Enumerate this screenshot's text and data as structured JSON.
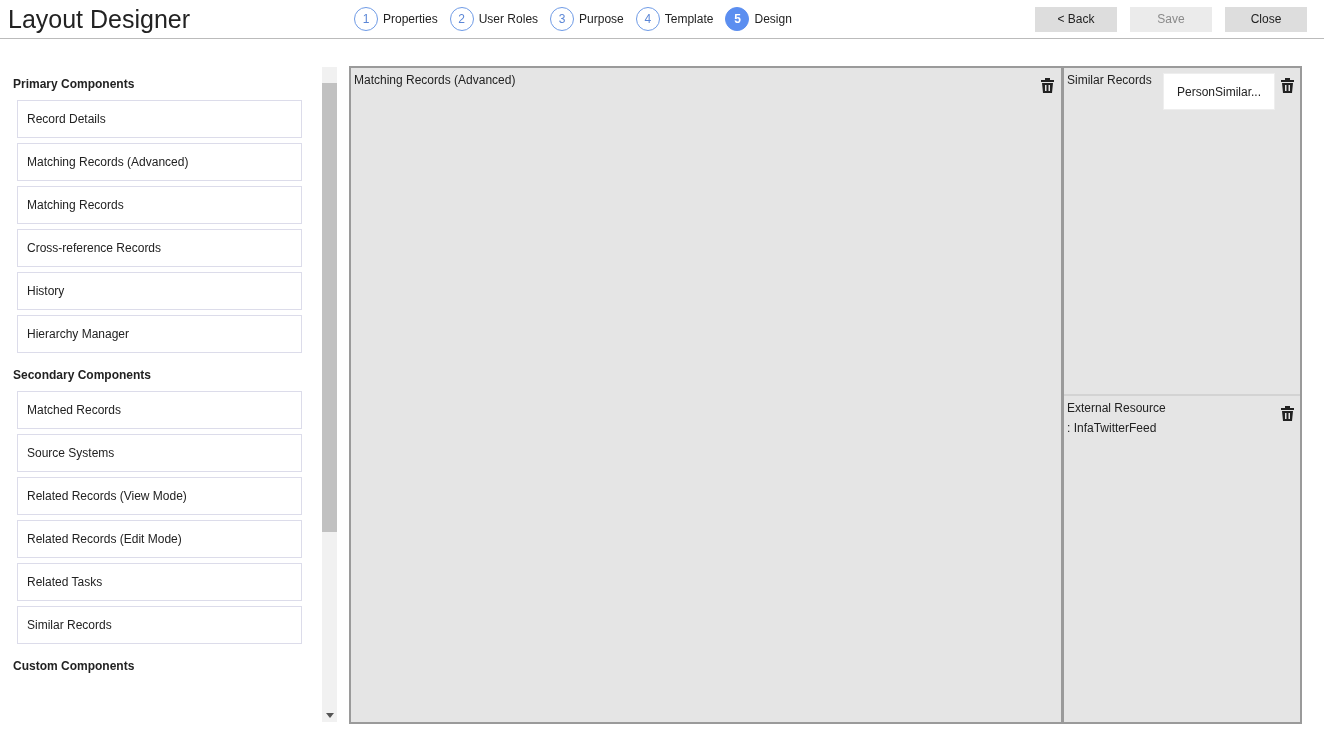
{
  "app_title": "Layout Designer",
  "steps": [
    {
      "number": "1",
      "label": "Properties",
      "selected": false
    },
    {
      "number": "2",
      "label": "User Roles",
      "selected": false
    },
    {
      "number": "3",
      "label": "Purpose",
      "selected": false
    },
    {
      "number": "4",
      "label": "Template",
      "selected": false
    },
    {
      "number": "5",
      "label": "Design",
      "selected": true
    }
  ],
  "buttons": [
    {
      "label": "< Back",
      "disabled": false
    },
    {
      "label": "Save",
      "disabled": true
    },
    {
      "label": "Close",
      "disabled": false
    }
  ],
  "component_groups": [
    {
      "title": "Primary Components",
      "items": [
        "Record Details",
        "Matching Records (Advanced)",
        "Matching Records",
        "Cross-reference Records",
        "History",
        "Hierarchy Manager"
      ]
    },
    {
      "title": "Secondary Components",
      "items": [
        "Matched Records",
        "Source Systems",
        "Related Records (View Mode)",
        "Related Records (Edit Mode)",
        "Related Tasks",
        "Similar Records"
      ]
    },
    {
      "title": "Custom Components"
    }
  ],
  "canvas": {
    "main_panel": {
      "title": "Matching Records (Advanced)"
    },
    "side_panels": [
      {
        "title": "Similar Records",
        "dropdown": "PersonSimilar..."
      },
      {
        "title": "External Resource",
        "subtitle": ": InfaTwitterFeed"
      }
    ]
  }
}
